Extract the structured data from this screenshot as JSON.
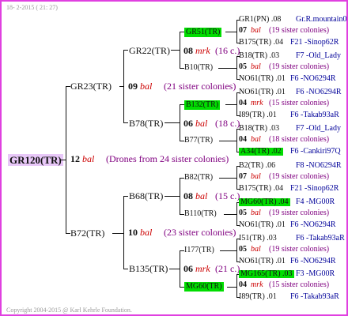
{
  "header": {
    "date_line": "18-  2-2015 ( 21: 27)"
  },
  "footer": {
    "copyright": "Copyright 2004-2015 @ Karl Kehrle Foundation."
  },
  "root": {
    "id": "GR120(TR)"
  },
  "center": {
    "num": "12",
    "note": "bal",
    "desc": "(Drones from 24 sister colonies)"
  },
  "gen1": {
    "upper": {
      "id": "GR23(TR)",
      "num": "09",
      "note": "bal",
      "desc": "(21 sister colonies)"
    },
    "lower": {
      "id": "B72(TR)",
      "num": "10",
      "note": "bal",
      "desc": "(23 sister colonies)"
    }
  },
  "gen2": {
    "gr22": {
      "id": "GR22(TR)",
      "num": "08",
      "note": "mrk",
      "desc": "(16 c.)"
    },
    "b78": {
      "id": "B78(TR)",
      "num": "06",
      "note": "bal",
      "desc": "(18 c.)"
    },
    "b68": {
      "id": "B68(TR)",
      "num": "08",
      "note": "bal",
      "desc": "(15 c.)"
    },
    "b135": {
      "id": "B135(TR)",
      "num": "06",
      "note": "mrk",
      "desc": "(21 c.)"
    }
  },
  "gen3": {
    "gr51": {
      "id": "GR51(TR)"
    },
    "b10": {
      "id": "B10(TR)"
    },
    "b132": {
      "id": "B132(TR)"
    },
    "b77": {
      "id": "B77(TR)"
    },
    "b82": {
      "id": "B82(TR)"
    },
    "b110": {
      "id": "B110(TR)"
    },
    "i177": {
      "id": "I177(TR)"
    },
    "mg60": {
      "id": "MG60(TR)"
    }
  },
  "gen4": [
    {
      "a": "GR1(PN) .08",
      "b": "Gr.R.mountain06Q",
      "num": "07",
      "note": "bal",
      "desc": "(19 sister colonies)",
      "c": "B175(TR) .04",
      "d": "F21 -Sinop62R"
    },
    {
      "a": "B18(TR) .03",
      "b": "F7 -Old_Lady",
      "num": "05",
      "note": "bal",
      "desc": "(19 sister colonies)",
      "c": "NO61(TR) .01",
      "d": "F6 -NO6294R"
    },
    {
      "a": "NO61(TR) .01",
      "b": "F6 -NO6294R",
      "num": "04",
      "note": "mrk",
      "desc": "(15 sister colonies)",
      "c": "I89(TR) .01",
      "d": "F6 -Takab93aR"
    },
    {
      "a": "B18(TR) .03",
      "b": "F7 -Old_Lady",
      "num": "04",
      "note": "bal",
      "desc": "(18 sister colonies)",
      "c": "A34(TR) .02",
      "d": "F6 -Cankiri97Q"
    },
    {
      "a": "B2(TR) .06",
      "b": "F8 -NO6294R",
      "num": "07",
      "note": "bal",
      "desc": "(19 sister colonies)",
      "c": "B175(TR) .04",
      "d": "F21 -Sinop62R"
    },
    {
      "a": "MG60(TR) .04",
      "b": "F4 -MG00R",
      "num": "05",
      "note": "bal",
      "desc": "(19 sister colonies)",
      "c": "NO61(TR) .01",
      "d": "F6 -NO6294R"
    },
    {
      "a": "I51(TR) .03",
      "b": "F6 -Takab93aR",
      "num": "05",
      "note": "bal",
      "desc": "(19 sister colonies)",
      "c": "NO61(TR) .01",
      "d": "F6 -NO6294R"
    },
    {
      "a": "MG165(TR) .03",
      "b": "F3 -MG00R",
      "num": "04",
      "note": "mrk",
      "desc": "(15 sister colonies)",
      "c": "I89(TR) .01",
      "d": "F6 -Takab93aR"
    }
  ],
  "colors": {
    "frame": "#e040e0",
    "root_highlight": "#e8c8f8",
    "green_highlight": "#00dd00",
    "note_red": "#cc0000",
    "desc_purple": "#800080",
    "ref_blue": "#000099"
  }
}
